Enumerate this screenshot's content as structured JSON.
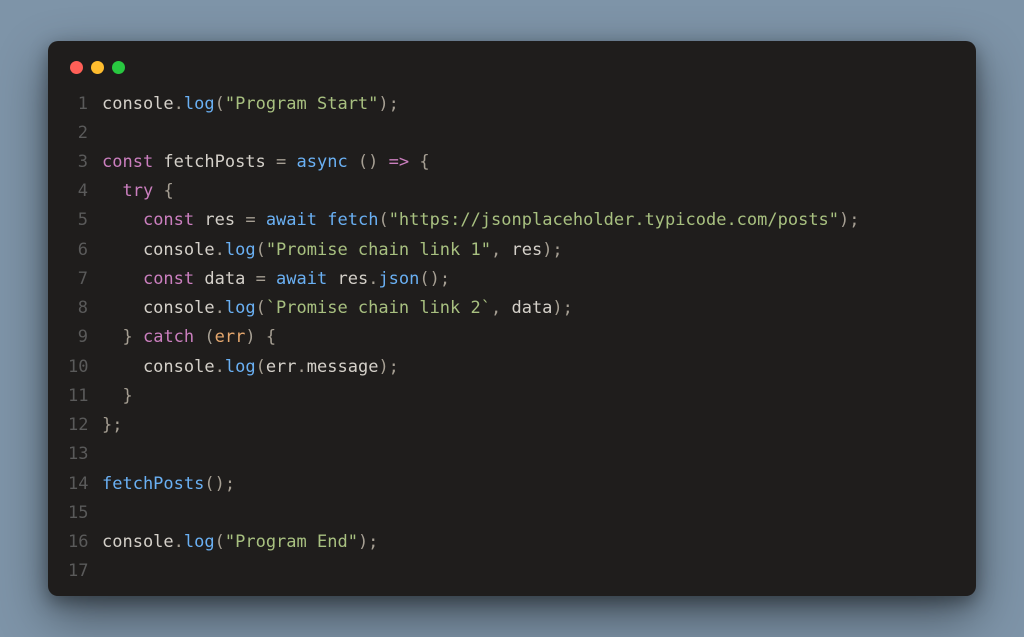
{
  "window": {
    "traffic_lights": [
      "red",
      "yellow",
      "green"
    ]
  },
  "colors": {
    "bg_page": "#7e94a8",
    "bg_window": "#1f1d1c",
    "red": "#ff5f57",
    "yellow": "#febc2e",
    "green": "#28c840",
    "gutter": "#5a5a5a",
    "ident": "#d4d0c9",
    "func": "#6ab0f3",
    "punct": "#a69f93",
    "string": "#a8c080",
    "kw_decl": "#cb7fbf",
    "kw_mod": "#6ab0f3",
    "arrow": "#cb7fbf",
    "param": "#e6a86e"
  },
  "code": {
    "line_numbers": [
      "1",
      "2",
      "3",
      "4",
      "5",
      "6",
      "7",
      "8",
      "9",
      "10",
      "11",
      "12",
      "13",
      "14",
      "15",
      "16",
      "17"
    ],
    "lines": [
      [
        {
          "cls": "tok-ident",
          "t": "console"
        },
        {
          "cls": "tok-punct",
          "t": "."
        },
        {
          "cls": "tok-func",
          "t": "log"
        },
        {
          "cls": "tok-punct",
          "t": "("
        },
        {
          "cls": "tok-string",
          "t": "\"Program Start\""
        },
        {
          "cls": "tok-punct",
          "t": ");"
        }
      ],
      [],
      [
        {
          "cls": "tok-kw-decl",
          "t": "const"
        },
        {
          "cls": "tok-ident",
          "t": " fetchPosts "
        },
        {
          "cls": "tok-punct",
          "t": "= "
        },
        {
          "cls": "tok-kw-mod",
          "t": "async"
        },
        {
          "cls": "tok-punct",
          "t": " () "
        },
        {
          "cls": "tok-arrow",
          "t": "=>"
        },
        {
          "cls": "tok-punct",
          "t": " {"
        }
      ],
      [
        {
          "cls": "tok-ident",
          "t": "  "
        },
        {
          "cls": "tok-kw-decl",
          "t": "try"
        },
        {
          "cls": "tok-punct",
          "t": " {"
        }
      ],
      [
        {
          "cls": "tok-ident",
          "t": "    "
        },
        {
          "cls": "tok-kw-decl",
          "t": "const"
        },
        {
          "cls": "tok-ident",
          "t": " res "
        },
        {
          "cls": "tok-punct",
          "t": "= "
        },
        {
          "cls": "tok-kw-mod",
          "t": "await"
        },
        {
          "cls": "tok-ident",
          "t": " "
        },
        {
          "cls": "tok-func",
          "t": "fetch"
        },
        {
          "cls": "tok-punct",
          "t": "("
        },
        {
          "cls": "tok-string",
          "t": "\"https://jsonplaceholder.typicode.com/posts\""
        },
        {
          "cls": "tok-punct",
          "t": ");"
        }
      ],
      [
        {
          "cls": "tok-ident",
          "t": "    console"
        },
        {
          "cls": "tok-punct",
          "t": "."
        },
        {
          "cls": "tok-func",
          "t": "log"
        },
        {
          "cls": "tok-punct",
          "t": "("
        },
        {
          "cls": "tok-string",
          "t": "\"Promise chain link 1\""
        },
        {
          "cls": "tok-punct",
          "t": ", "
        },
        {
          "cls": "tok-ident",
          "t": "res"
        },
        {
          "cls": "tok-punct",
          "t": ");"
        }
      ],
      [
        {
          "cls": "tok-ident",
          "t": "    "
        },
        {
          "cls": "tok-kw-decl",
          "t": "const"
        },
        {
          "cls": "tok-ident",
          "t": " data "
        },
        {
          "cls": "tok-punct",
          "t": "= "
        },
        {
          "cls": "tok-kw-mod",
          "t": "await"
        },
        {
          "cls": "tok-ident",
          "t": " res"
        },
        {
          "cls": "tok-punct",
          "t": "."
        },
        {
          "cls": "tok-func",
          "t": "json"
        },
        {
          "cls": "tok-punct",
          "t": "();"
        }
      ],
      [
        {
          "cls": "tok-ident",
          "t": "    console"
        },
        {
          "cls": "tok-punct",
          "t": "."
        },
        {
          "cls": "tok-func",
          "t": "log"
        },
        {
          "cls": "tok-punct",
          "t": "("
        },
        {
          "cls": "tok-string",
          "t": "`Promise chain link 2`"
        },
        {
          "cls": "tok-punct",
          "t": ", "
        },
        {
          "cls": "tok-ident",
          "t": "data"
        },
        {
          "cls": "tok-punct",
          "t": ");"
        }
      ],
      [
        {
          "cls": "tok-ident",
          "t": "  "
        },
        {
          "cls": "tok-punct",
          "t": "} "
        },
        {
          "cls": "tok-kw-decl",
          "t": "catch"
        },
        {
          "cls": "tok-punct",
          "t": " ("
        },
        {
          "cls": "tok-param",
          "t": "err"
        },
        {
          "cls": "tok-punct",
          "t": ") {"
        }
      ],
      [
        {
          "cls": "tok-ident",
          "t": "    console"
        },
        {
          "cls": "tok-punct",
          "t": "."
        },
        {
          "cls": "tok-func",
          "t": "log"
        },
        {
          "cls": "tok-punct",
          "t": "("
        },
        {
          "cls": "tok-ident",
          "t": "err"
        },
        {
          "cls": "tok-punct",
          "t": "."
        },
        {
          "cls": "tok-ident",
          "t": "message"
        },
        {
          "cls": "tok-punct",
          "t": ");"
        }
      ],
      [
        {
          "cls": "tok-ident",
          "t": "  "
        },
        {
          "cls": "tok-punct",
          "t": "}"
        }
      ],
      [
        {
          "cls": "tok-punct",
          "t": "};"
        }
      ],
      [],
      [
        {
          "cls": "tok-func",
          "t": "fetchPosts"
        },
        {
          "cls": "tok-punct",
          "t": "();"
        }
      ],
      [],
      [
        {
          "cls": "tok-ident",
          "t": "console"
        },
        {
          "cls": "tok-punct",
          "t": "."
        },
        {
          "cls": "tok-func",
          "t": "log"
        },
        {
          "cls": "tok-punct",
          "t": "("
        },
        {
          "cls": "tok-string",
          "t": "\"Program End\""
        },
        {
          "cls": "tok-punct",
          "t": ");"
        }
      ],
      []
    ]
  }
}
